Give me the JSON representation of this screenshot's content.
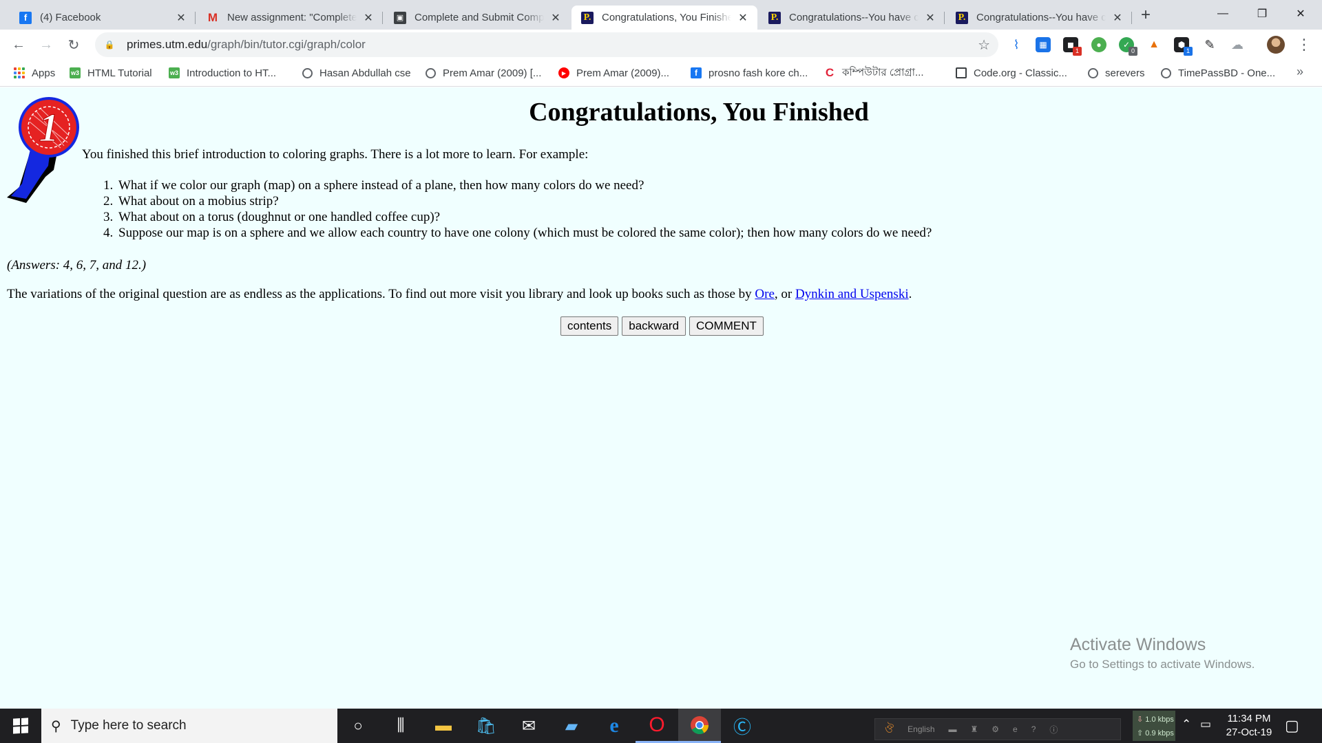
{
  "browser": {
    "tabs": [
      {
        "title": "(4) Facebook",
        "favicon": "facebook-icon",
        "active": false
      },
      {
        "title": "New assignment: \"Complete",
        "favicon": "gmail-icon",
        "active": false
      },
      {
        "title": "Complete and Submit Comp",
        "favicon": "classroom-icon",
        "active": false
      },
      {
        "title": "Congratulations, You Finishe",
        "favicon": "primes-icon",
        "active": true
      },
      {
        "title": "Congratulations--You have c",
        "favicon": "primes-icon",
        "active": false
      },
      {
        "title": "Congratulations--You have c",
        "favicon": "primes-icon",
        "active": false
      }
    ],
    "tab_favicon_letters": {
      "facebook": "f",
      "gmail": "M",
      "primes": "P."
    },
    "url_host": "primes.utm.edu",
    "url_path": "/graph/bin/tutor.cgi/graph/color",
    "extension_badges": [
      "1",
      "0",
      "1"
    ],
    "bookmarks": [
      {
        "label": "Apps",
        "icon": "apps-grid-icon"
      },
      {
        "label": "HTML Tutorial",
        "icon": "w3schools-icon"
      },
      {
        "label": "Introduction to HT...",
        "icon": "w3schools-icon"
      },
      {
        "label": "Hasan Abdullah cse",
        "icon": "globe-icon"
      },
      {
        "label": "Prem Amar (2009) [...",
        "icon": "globe-icon"
      },
      {
        "label": "Prem Amar (2009)...",
        "icon": "youtube-icon"
      },
      {
        "label": "prosno fash kore ch...",
        "icon": "facebook-icon"
      },
      {
        "label": "কম্পিউটার প্রোগ্রা...",
        "icon": "c-logo-icon"
      },
      {
        "label": "Code.org - Classic...",
        "icon": "code-org-icon"
      },
      {
        "label": "serevers",
        "icon": "globe-icon"
      },
      {
        "label": "TimePassBD - One...",
        "icon": "globe-icon"
      }
    ],
    "bookmark_favicon_letters": {
      "w3schools": "w3",
      "facebook": "f",
      "c_logo": "C"
    }
  },
  "page": {
    "heading": "Congratulations, You Finished",
    "intro": "You finished this brief introduction to coloring graphs. There is a lot more to learn. For example:",
    "questions": [
      "What if we color our graph (map) on a sphere instead of a plane, then how many colors do we need?",
      "What about on a mobius strip?",
      "What about on a torus (doughnut or one handled coffee cup)?",
      "Suppose our map is on a sphere and we allow each country to have one colony (which must be colored the same color); then how many colors do we need?"
    ],
    "answers": "(Answers: 4, 6, 7, and 12.)",
    "variations_text": "The variations of the original question are as endless as the applications.  To find out more visit you library and look up books such as those by ",
    "link_ore": "Ore",
    "sep_or": ", or ",
    "link_dynkin": "Dynkin and Uspenski",
    "end_period": ".",
    "buttons": {
      "contents": "contents",
      "backward": "backward",
      "comment": "COMMENT"
    },
    "ribbon_number": "1",
    "background_color": "#f0ffff",
    "link_color": "#0000ee"
  },
  "watermark": {
    "line1": "Activate Windows",
    "line2": "Go to Settings to activate Windows."
  },
  "taskbar": {
    "search_placeholder": "Type here to search",
    "tray_language": "English",
    "net_down": "1.0 kbps",
    "net_up": "0.9 kbps",
    "time": "11:34 PM",
    "date": "27-Oct-19"
  }
}
